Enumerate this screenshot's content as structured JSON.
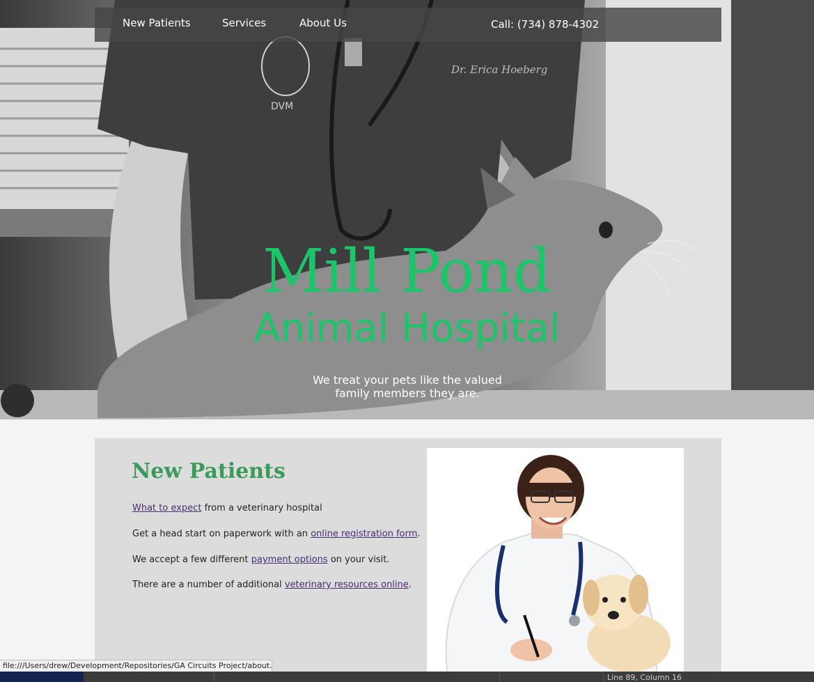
{
  "nav": {
    "items": [
      "New Patients",
      "Services",
      "About Us"
    ],
    "phone": "Call: (734) 878-4302"
  },
  "hero": {
    "title_line1": "Mill Pond",
    "title_line2": "Animal Hospital",
    "tagline_line1": "We treat your pets like the valued",
    "tagline_line2": "family members they are.",
    "scrub_badge": "DVM",
    "scrub_name": "Dr. Erica Hoeberg"
  },
  "new_patients": {
    "heading": "New Patients",
    "p1_link": "What to expect",
    "p1_text": " from a veterinary hospital",
    "p2_text": "Get a head start on paperwork with an ",
    "p2_link": "online registration form",
    "p2_end": ".",
    "p3_text": "We accept a few different ",
    "p3_link": "payment options",
    "p3_end": " on your visit.",
    "p4_text": "There are a number of additional ",
    "p4_link": "veterinary resources online",
    "p4_end": "."
  },
  "status": {
    "url": "file:///Users/drew/Development/Repositories/GA Circuits Project/about.html",
    "line_info": "Line 89, Column 16"
  },
  "colors": {
    "title_green": "#1ec46a",
    "heading_green": "#3a9a5a",
    "link_purple": "#4b2a73",
    "nav_bg": "#464646"
  }
}
